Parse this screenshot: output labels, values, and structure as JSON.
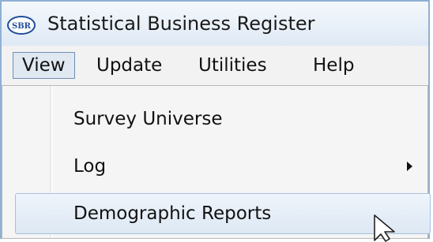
{
  "window": {
    "title": "Statistical Business Register",
    "icon": {
      "name": "sbr-logo-icon",
      "text": "SBR"
    }
  },
  "menubar": {
    "items": [
      {
        "label": "View",
        "open": true
      },
      {
        "label": "Update"
      },
      {
        "label": "Utilities"
      },
      {
        "label": "Help"
      }
    ]
  },
  "view_menu": {
    "items": [
      {
        "label": "Survey Universe"
      },
      {
        "label": "Log",
        "has_submenu": true
      },
      {
        "label": "Demographic Reports",
        "hovered": true
      }
    ]
  },
  "colors": {
    "title_bar": "#dfe9f5",
    "menu_open_border": "#6f90b5",
    "hover_highlight": "#dde8f4"
  }
}
